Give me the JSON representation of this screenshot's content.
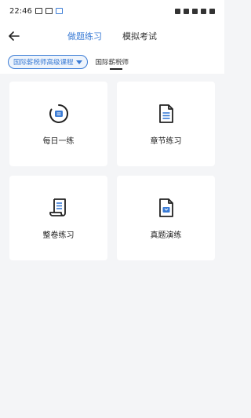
{
  "status": {
    "time": "22:46"
  },
  "nav": {
    "tabs": [
      {
        "label": "做题练习",
        "active": true
      },
      {
        "label": "模拟考试",
        "active": false
      }
    ]
  },
  "filter": {
    "course": "国际薪税师高级课程",
    "subject": "国际薪税师"
  },
  "cards": [
    {
      "label": "每日一练",
      "icon": "daily-practice-icon"
    },
    {
      "label": "章节练习",
      "icon": "chapter-practice-icon"
    },
    {
      "label": "整卷练习",
      "icon": "full-paper-icon"
    },
    {
      "label": "真题演练",
      "icon": "real-exam-icon"
    }
  ],
  "colors": {
    "accent": "#3a7bd5",
    "background": "#f4f5f7",
    "card": "#ffffff"
  }
}
